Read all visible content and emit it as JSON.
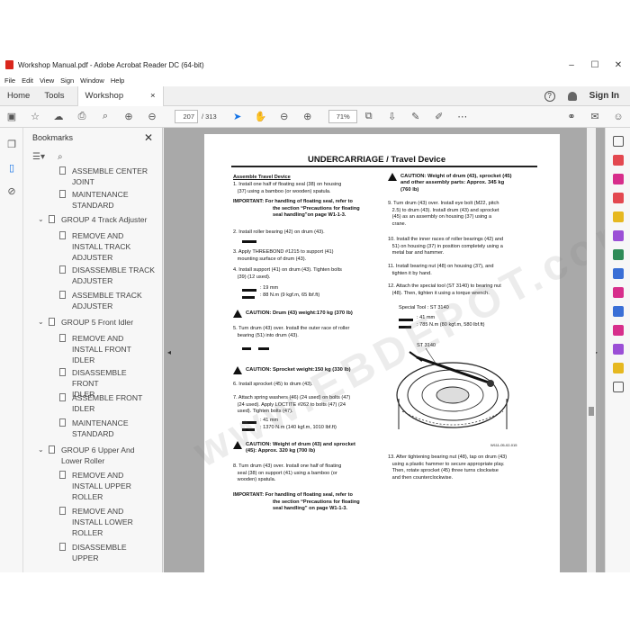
{
  "window": {
    "title": "Workshop Manual.pdf - Adobe Acrobat Reader DC (64-bit)",
    "min": "–",
    "max": "☐",
    "close": "✕"
  },
  "menu": [
    "File",
    "Edit",
    "View",
    "Sign",
    "Window",
    "Help"
  ],
  "tabs": {
    "home": "Home",
    "tools": "Tools",
    "doc": "Workshop Manual...",
    "doc_close": "×",
    "help": "?",
    "signin": "Sign In"
  },
  "toolbar": {
    "page_current": "207",
    "page_total": "/ 313",
    "zoom": "71%"
  },
  "bookmarks": {
    "title": "Bookmarks",
    "close": "✕",
    "items": [
      {
        "label": "ASSEMBLE CENTER",
        "label2": "JOINT"
      },
      {
        "label": "MAINTENANCE",
        "label2": "STANDARD"
      },
      {
        "label": "GROUP 4 Track Adjuster"
      },
      {
        "label": "REMOVE AND",
        "label2": "INSTALL TRACK",
        "label3": "ADJUSTER"
      },
      {
        "label": "DISASSEMBLE TRACK",
        "label2": "ADJUSTER"
      },
      {
        "label": "ASSEMBLE TRACK",
        "label2": "ADJUSTER"
      },
      {
        "label": "GROUP 5 Front Idler"
      },
      {
        "label": "REMOVE AND",
        "label2": "INSTALL FRONT",
        "label3": "IDLER"
      },
      {
        "label": "DISASSEMBLE FRONT",
        "label2": "IDLER"
      },
      {
        "label": "ASSEMBLE FRONT",
        "label2": "IDLER"
      },
      {
        "label": "MAINTENANCE",
        "label2": "STANDARD"
      },
      {
        "label": "GROUP 6 Upper And",
        "label2": "Lower Roller"
      },
      {
        "label": "REMOVE AND",
        "label2": "INSTALL UPPER",
        "label3": "ROLLER"
      },
      {
        "label": "REMOVE AND",
        "label2": "INSTALL LOWER",
        "label3": "ROLLER"
      },
      {
        "label": "DISASSEMBLE UPPER"
      }
    ]
  },
  "page": {
    "header": "UNDERCARRIAGE / Travel Device",
    "left": {
      "heading": "Assemble Travel Device",
      "s1": "1.  Install one half of floating seal (38) on housing",
      "s1b": "(37) using a bamboo (or wooden) spatula.",
      "imp1a": "IMPORTANT:  For handling of floating seal, refer to",
      "imp1b": "the section “Precautions for floating",
      "imp1c": "seal handling”on page W1-1-3.",
      "s2": "2.  Install roller bearing (42) on drum (43).",
      "s3a": "3.  Apply THREEBOND #1215 to support (41)",
      "s3b": "mounting surface of drum (43).",
      "s4a": "4.  Install support (41) on drum (43). Tighten bolts",
      "s4b": "(39) (12 used).",
      "s4c": ": 19 mm",
      "s4d": ": 88 N.m (9 kgf.m, 65 lbf.ft)",
      "caut1": "CAUTION:  Drum (43) weight:170 kg (370 lb)",
      "s5a": "5.  Turn drum (43) over. Install the outer race of roller",
      "s5b": "bearing (51) into drum (43).",
      "caut2": "CAUTION:  Sprocket weight:150 kg (330 lb)",
      "s6": "6.  Install sprocket (45) to drum (43).",
      "s7a": "7.  Attach spring washers (46) (24 used) on bolts (47)",
      "s7b": "(24 used). Apply LOCTITE #262 to bolts (47) (24",
      "s7c": "used). Tighten bolts (47).",
      "s7d": ": 41 mm",
      "s7e": ": 1370 N.m (140 kgf.m, 1010 lbf.ft)",
      "caut3a": "CAUTION:  Weight of drum (43) and sprocket",
      "caut3b": "(45): Approx. 320 kg (700 lb)",
      "s8a": "8.  Turn drum (43) over. Install one half of floating",
      "s8b": "seal (38) on support (41) using a bamboo (or",
      "s8c": "wooden) spatula.",
      "imp2a": "IMPORTANT:  For handling of floating seal, refer to",
      "imp2b": "the section “Precautions for floating",
      "imp2c": "seal handling” on page W1-1-3."
    },
    "right": {
      "caut4a": "CAUTION:  Weight of drum (43), sprocket (45)",
      "caut4b": "and other assembly parts: Approx. 345 kg",
      "caut4c": "(760 lb)",
      "s9a": "9.  Turn drum (43) over. Install eye bolt (M22, pitch",
      "s9b": "2.5) to drum (43). Install drum (43) and sprocket",
      "s9c": "(45) as an assembly on housing (37) using a",
      "s9d": "crane.",
      "s10a": "10. Install the inner races of roller bearings (42) and",
      "s10b": "51) on housing (37) in position completely using a",
      "s10c": "metal bar and hammer.",
      "s11a": "11. Install bearing nut (48) on housing (37), and",
      "s11b": "tighten it by hand.",
      "s12a": "12. Attach the special tool (ST 3140) to bearing nut",
      "s12b": "(48). Then, tighten it using a torque wrench.",
      "special": "Special Tool : ST 3140",
      "s12c": ": 41 mm",
      "s12d": ": 785 N.m (80 kgf.m, 580 lbf.ft)",
      "fig_label": "ST 3140",
      "fig_code": "W111-05-02-015",
      "s13a": "13. After tightening bearing nut (48), tap on drum (43)",
      "s13b": "using a plastic hammer to secure appropriate play.",
      "s13c": "Then, rotate sprocket (45) three turns clockwise",
      "s13d": "and then counterclockwise."
    },
    "watermark": "www.EBDEPOT.com"
  }
}
